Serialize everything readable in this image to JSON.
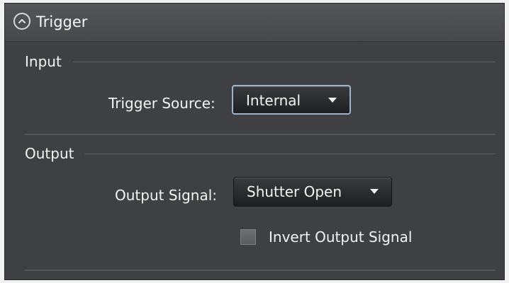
{
  "header": {
    "title": "Trigger",
    "collapse_icon": "chevron-up-circle-icon"
  },
  "input_section": {
    "label": "Input",
    "trigger_source_label": "Trigger Source:",
    "trigger_source_value": "Internal"
  },
  "output_section": {
    "label": "Output",
    "output_signal_label": "Output Signal:",
    "output_signal_value": "Shutter Open",
    "invert_label": "Invert Output Signal",
    "invert_checked": false
  },
  "colors": {
    "panel_bg": "#3f4043",
    "header_bg": "#4e4f52",
    "text": "#f4f4f4",
    "focus_border": "#9fb3c8"
  }
}
